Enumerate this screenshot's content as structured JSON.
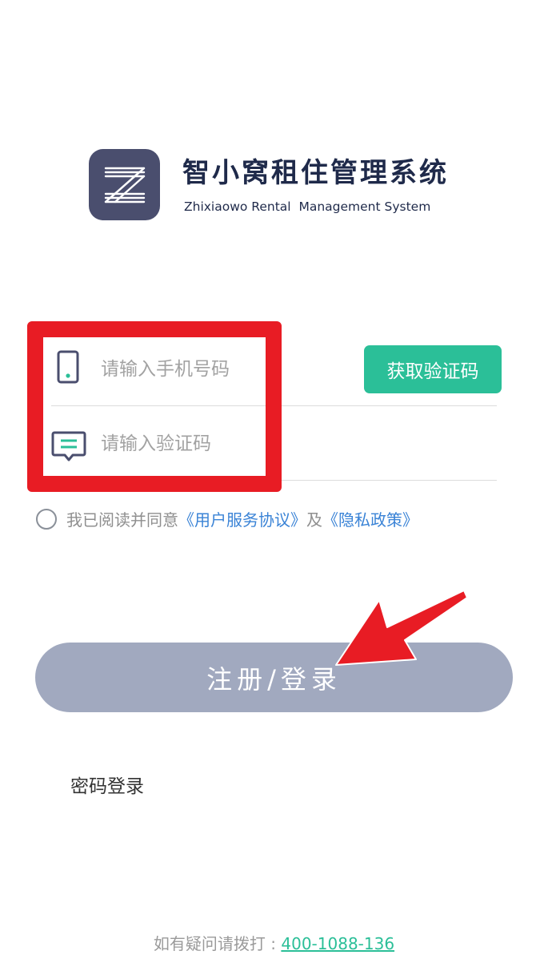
{
  "brand": {
    "app_name": "智小窝租住管理系统",
    "app_name_en": "Zhixiaowo Rental  Management System",
    "logo_icon": "z-logo-icon"
  },
  "form": {
    "phone": {
      "placeholder": "请输入手机号码",
      "value": "",
      "icon": "phone-icon"
    },
    "code": {
      "placeholder": "请输入验证码",
      "value": "",
      "icon": "message-icon"
    },
    "get_code_label": "获取验证码"
  },
  "agreement": {
    "checked": false,
    "prefix": "我已阅读并同意",
    "terms_link": "《用户服务协议》",
    "conjunction": "及",
    "privacy_link": "《隐私政策》"
  },
  "submit_label": "注册/登录",
  "password_login_label": "密码登录",
  "footer": {
    "label": "如有疑问请拨打 : ",
    "phone": "400-1088-136"
  },
  "colors": {
    "accent": "#2bbf98",
    "brand_dark": "#1f2a4a",
    "logo_bg": "#4a4e6e",
    "submit_disabled": "#a1a9bf",
    "link": "#3a83d6",
    "annotation_red": "#e81c24"
  }
}
